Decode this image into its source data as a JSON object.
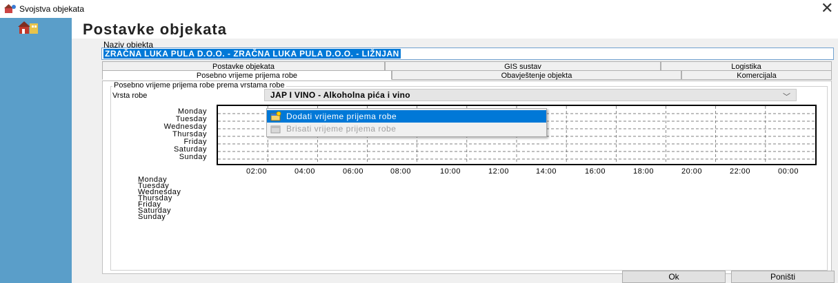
{
  "window": {
    "title": "Svojstva objekata",
    "close_glyph": "✕"
  },
  "header": {
    "title": "Postavke objekata"
  },
  "naziv": {
    "label": "Naziv objekta",
    "value": "ZRAČNA LUKA PULA D.O.O. - ZRAČNA LUKA PULA D.O.O. - LIŽNJAN"
  },
  "tabs": {
    "row1": [
      "Postavke objekata",
      "GIS sustav",
      "Logistika"
    ],
    "row2": [
      "Posebno vrijeme prijema robe",
      "Obavještenje objekta",
      "Komercijala"
    ],
    "active": "Posebno vrijeme prijema robe"
  },
  "group": {
    "title": "Posebno vrijeme prijema robe prema vrstama robe",
    "vrsta_label": "Vrsta robe",
    "vrsta_value": "JAP I VINO  -  Alkoholna pića i vino"
  },
  "schedule": {
    "days": [
      "Monday",
      "Tuesday",
      "Wednesday",
      "Thursday",
      "Friday",
      "Saturday",
      "Sunday"
    ],
    "times": [
      "02:00",
      "04:00",
      "06:00",
      "08:00",
      "10:00",
      "12:00",
      "14:00",
      "16:00",
      "18:00",
      "20:00",
      "22:00",
      "00:00"
    ],
    "legend_days": [
      "Monday",
      "Tuesday",
      "Wednesday",
      "Thursday",
      "Friday",
      "Saturday",
      "Sunday"
    ]
  },
  "context_menu": {
    "items": [
      {
        "label": "Dodati vrijeme prijema robe",
        "icon": "add-time-icon",
        "state": "highlighted"
      },
      {
        "label": "Brisati vrijeme prijema robe",
        "icon": "delete-time-icon",
        "state": "disabled"
      }
    ]
  },
  "buttons": {
    "ok": "Ok",
    "cancel": "Poništi"
  },
  "colors": {
    "sidebar": "#5a9ec9",
    "selection": "#0078d7",
    "menu_highlight": "#0078d7"
  }
}
